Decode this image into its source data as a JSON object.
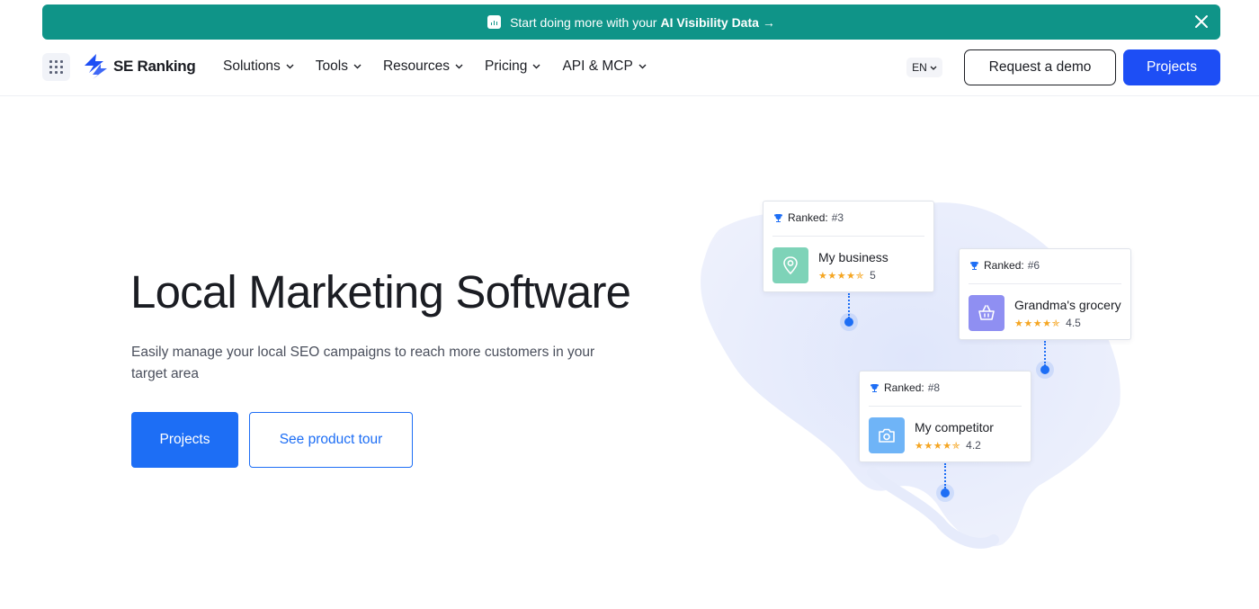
{
  "banner": {
    "text": "Start doing more with your",
    "bold": "AI Visibility Data",
    "arrow": "→"
  },
  "header": {
    "logo": "SE Ranking",
    "nav": [
      {
        "label": "Solutions"
      },
      {
        "label": "Tools"
      },
      {
        "label": "Resources"
      },
      {
        "label": "Pricing"
      },
      {
        "label": "API & MCP"
      }
    ],
    "lang": "EN",
    "demo_label": "Request a demo",
    "projects_label": "Projects"
  },
  "hero": {
    "title": "Local Marketing Software",
    "subtitle": "Easily manage your local SEO campaigns to reach more customers in your target area",
    "primary_label": "Projects",
    "secondary_label": "See product tour"
  },
  "cards": [
    {
      "ranked_label": "Ranked:",
      "rank": "#3",
      "name": "My business",
      "stars": "★★★★✯",
      "rating": "5",
      "tile_color": "#7ed3b8",
      "icon": "location-pin-icon"
    },
    {
      "ranked_label": "Ranked:",
      "rank": "#6",
      "name": "Grandma's grocery",
      "stars": "★★★★✯",
      "rating": "4.5",
      "tile_color": "#8f8ff2",
      "icon": "basket-icon"
    },
    {
      "ranked_label": "Ranked:",
      "rank": "#8",
      "name": "My competitor",
      "stars": "★★★★✯",
      "rating": "4.2",
      "tile_color": "#6fb4f7",
      "icon": "camera-icon"
    }
  ],
  "colors": {
    "banner": "#0f9488",
    "primary": "#1d4ef5",
    "link": "#1d6ef5",
    "star": "#f5a623",
    "map": "#e4e9fb"
  }
}
